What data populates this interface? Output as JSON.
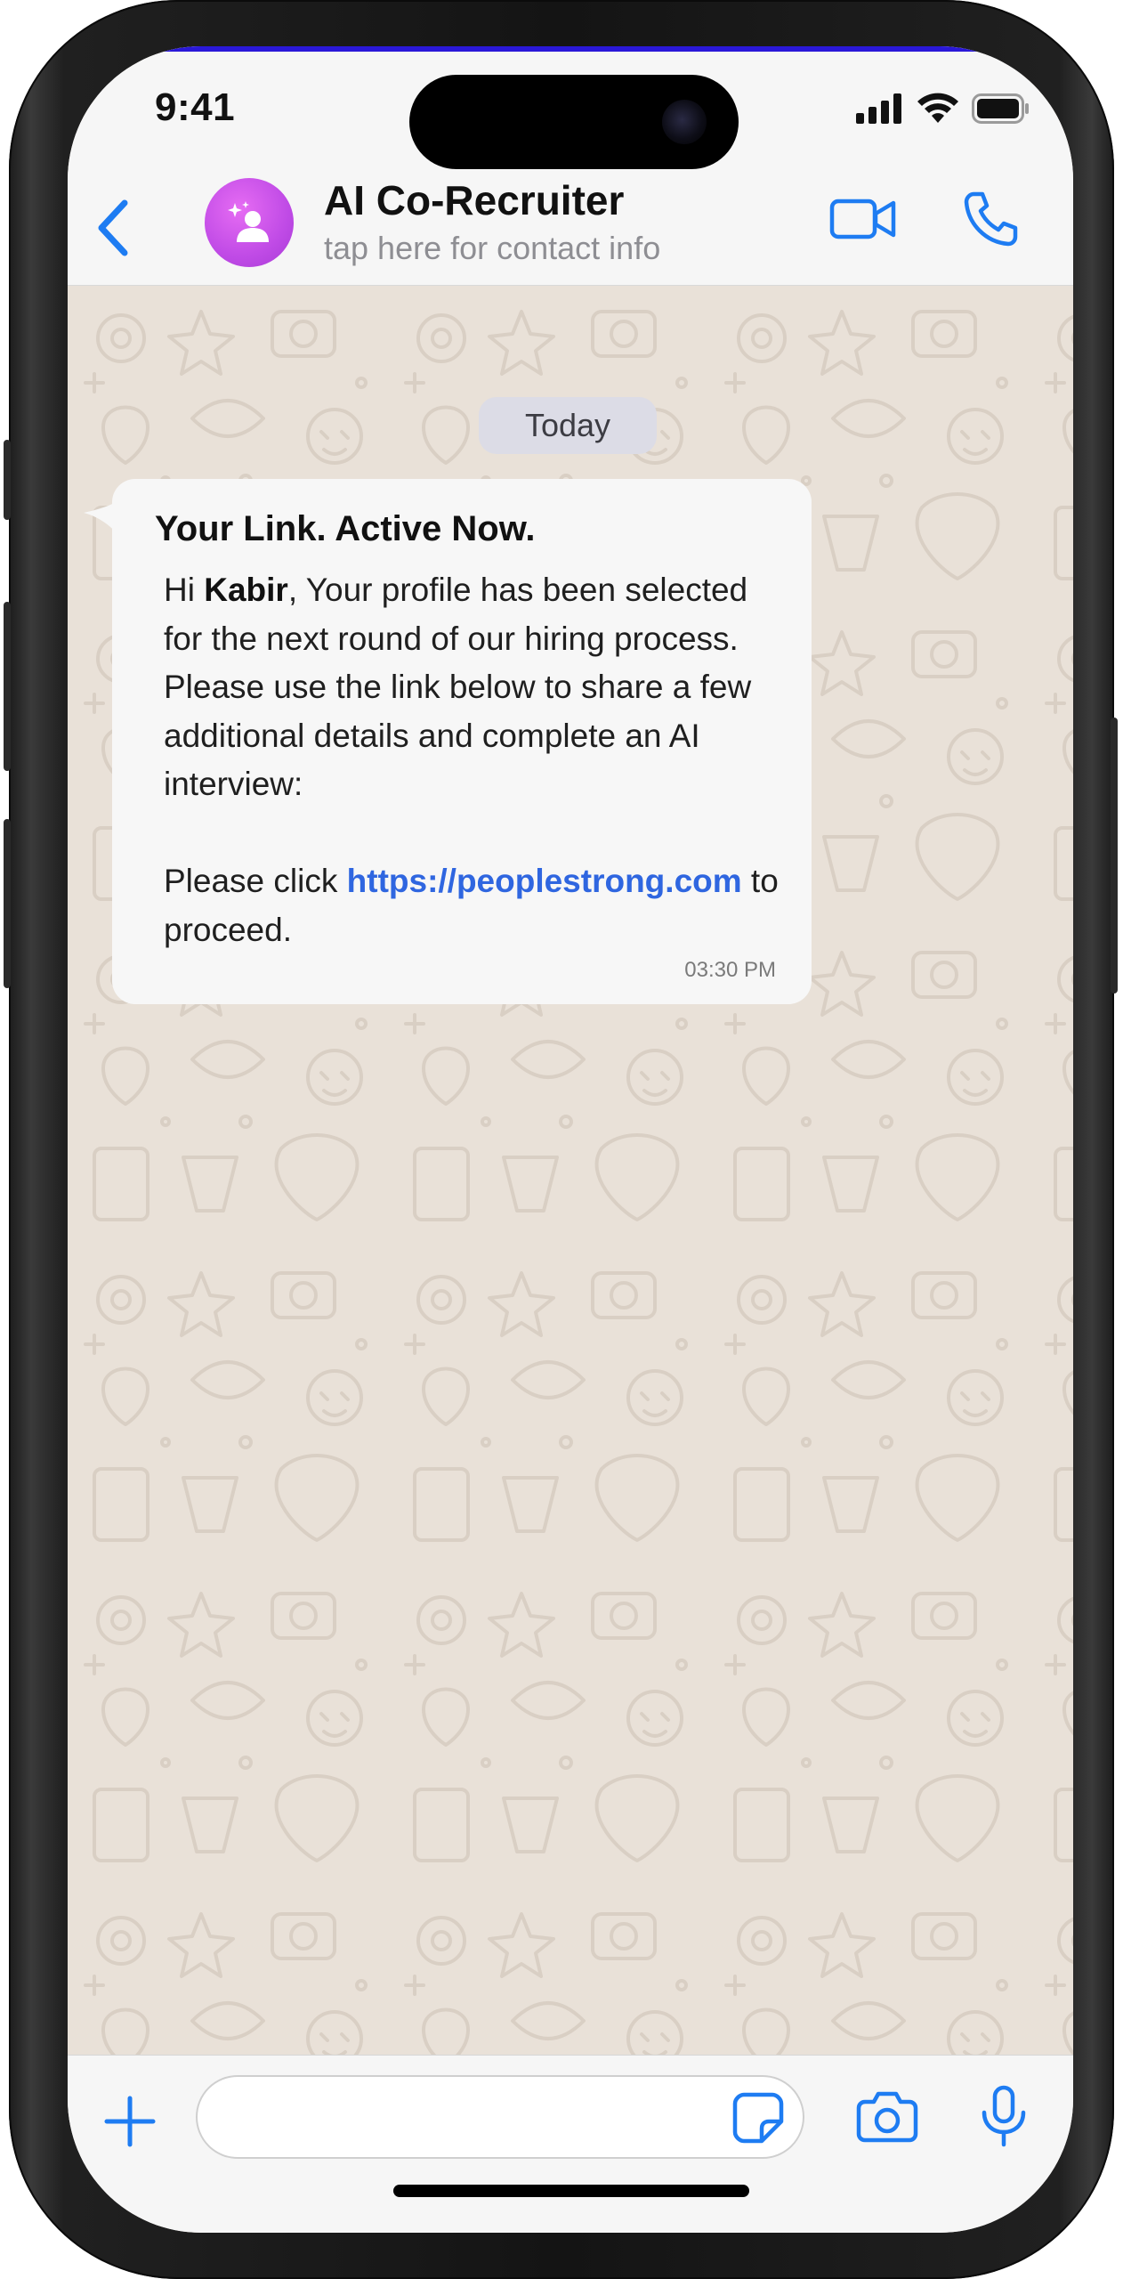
{
  "status_bar": {
    "time": "9:41"
  },
  "header": {
    "contact_name": "AI Co-Recruiter",
    "contact_subtitle": "tap here for contact info",
    "avatar_icon": "person-sparkle-icon",
    "accent_color": "#1e7cf2",
    "avatar_color": "#c04be6"
  },
  "chat": {
    "date_label": "Today",
    "message": {
      "title": "Your Link. Active Now.",
      "greeting": "Hi ",
      "name": "Kabir",
      "body": ", Your profile has been selected for the next round of our hiring process. Please use the link below to share a few additional details and complete an AI interview:",
      "cta_prefix": "Please click ",
      "link": "https://peoplestrong.com",
      "cta_suffix": " to proceed.",
      "time": "03:30 PM"
    },
    "background_color": "#e9e1d8",
    "link_color": "#2f66e0"
  },
  "composer": {
    "placeholder": "",
    "icons": [
      "plus-icon",
      "sticker-icon",
      "camera-icon",
      "microphone-icon"
    ]
  }
}
